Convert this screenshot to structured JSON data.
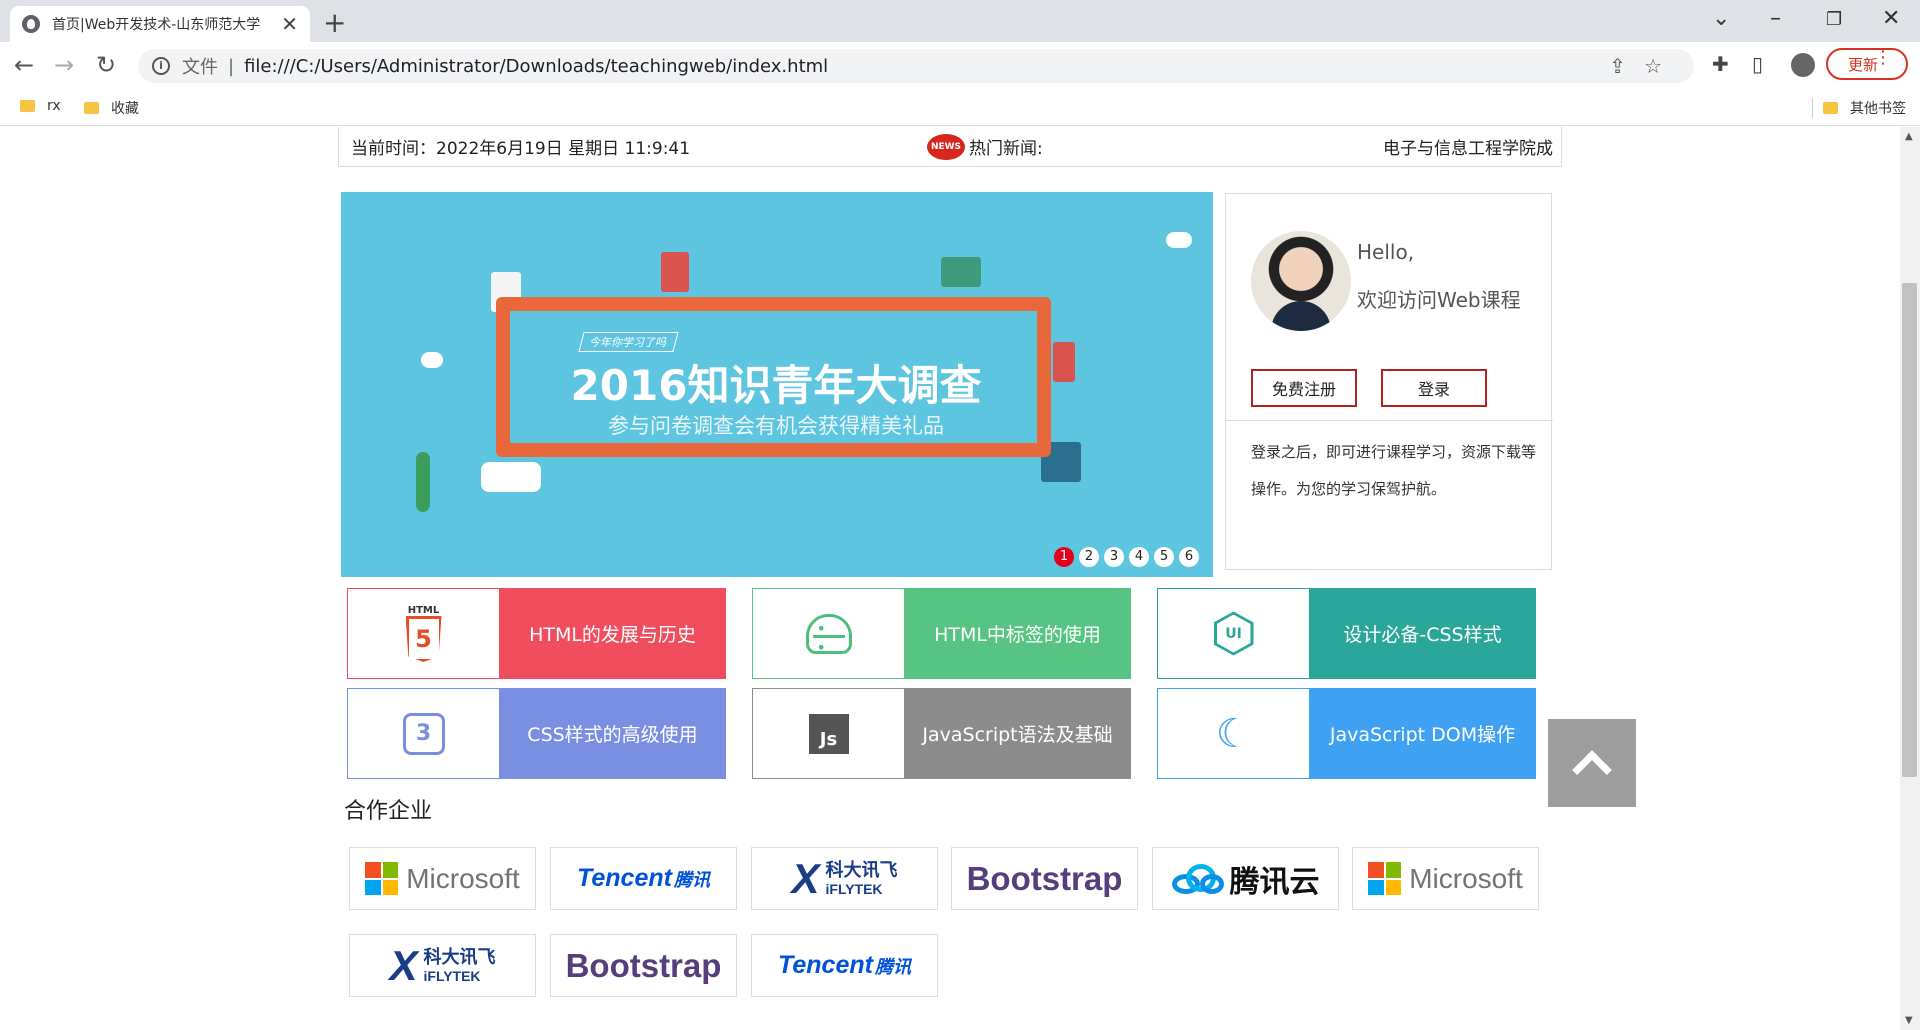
{
  "browser": {
    "tab_title": "首页|Web开发技术-山东师范大学",
    "address_prefix": "文件",
    "url": "file:///C:/Users/Administrator/Downloads/teachingweb/index.html",
    "update_label": "更新",
    "bookmarks": [
      "rx",
      "收藏"
    ],
    "other_bookmarks": "其他书签"
  },
  "header": {
    "time_label": "当前时间：",
    "time_value": "2022年6月19日 星期日 11:9:41",
    "news_badge": "NEWS",
    "news_label": "热门新闻:",
    "school": "电子与信息工程学院成"
  },
  "banner": {
    "tag": "今年你学习了吗",
    "title": "2016知识青年大调查",
    "subtitle": "参与问卷调查会有机会获得精美礼品",
    "pages": [
      "1",
      "2",
      "3",
      "4",
      "5",
      "6"
    ],
    "active_page": 1
  },
  "user_card": {
    "hello": "Hello,",
    "welcome": "欢迎访问Web课程",
    "register_label": "免费注册",
    "login_label": "登录",
    "desc": "登录之后，即可进行课程学习，资源下载等操作。为您的学习保驾护航。"
  },
  "courses": [
    {
      "label": "HTML的发展与历史",
      "icon": "html5-icon",
      "icon_text": "5",
      "color": "#f04d5e"
    },
    {
      "label": "HTML中标签的使用",
      "icon": "android-icon",
      "icon_text": "",
      "color": "#57c483"
    },
    {
      "label": "设计必备-CSS样式",
      "icon": "ui-hexagon-icon",
      "icon_text": "UI",
      "color": "#2aa79a"
    },
    {
      "label": "CSS样式的高级使用",
      "icon": "css3-icon",
      "icon_text": "3",
      "color": "#7b8fe2"
    },
    {
      "label": "JavaScript语法及基础",
      "icon": "js-icon",
      "icon_text": "Js",
      "color": "#8c8c8c"
    },
    {
      "label": "JavaScript DOM操作",
      "icon": "moon-icon",
      "icon_text": "☾",
      "color": "#3ea1f2"
    }
  ],
  "partners": {
    "title": "合作企业",
    "microsoft": "Microsoft",
    "tencent_en": "Tencent",
    "tencent_cn": "腾讯",
    "iflytek_cn": "科大讯飞",
    "iflytek_en": "iFLYTEK",
    "bootstrap": "Bootstrap",
    "tencent_cloud": "腾讯云"
  }
}
